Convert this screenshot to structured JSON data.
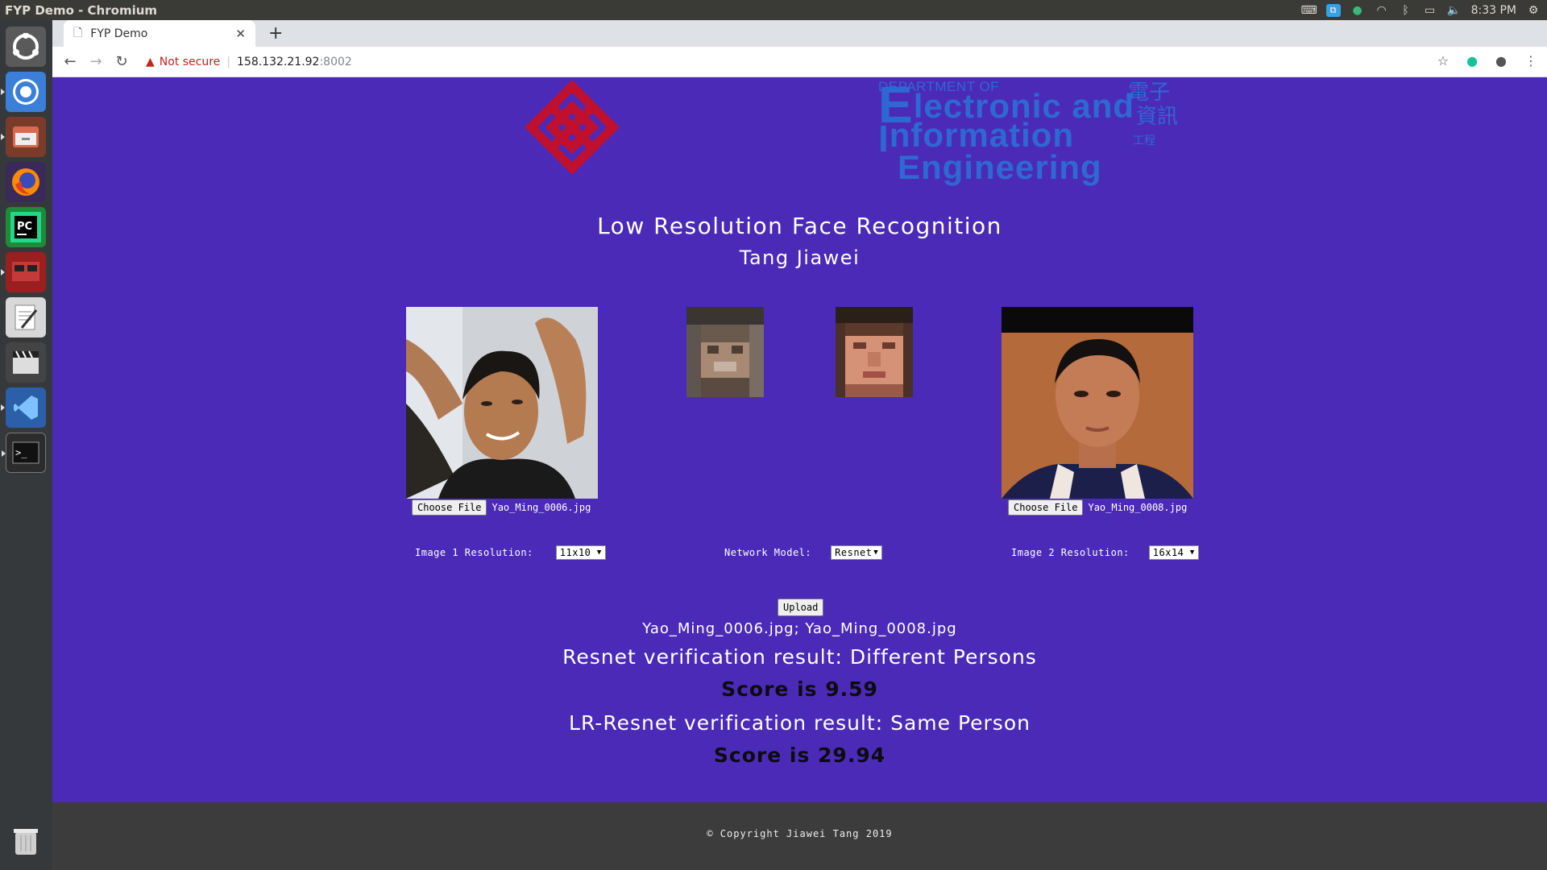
{
  "os": {
    "window_title": "FYP Demo - Chromium",
    "clock": "8:33 PM",
    "tray_icons": [
      "keyboard-icon",
      "app-indicator-icon",
      "bluetooth-alt-icon",
      "wifi-icon",
      "bluetooth-icon",
      "battery-icon",
      "volume-icon",
      "settings-icon"
    ],
    "launcher": [
      "ubuntu-dash-icon",
      "chromium-icon",
      "files-icon",
      "firefox-icon",
      "pycharm-icon",
      "remote-desktop-icon",
      "text-editor-icon",
      "video-editor-icon",
      "vscode-icon",
      "terminal-icon",
      "trash-icon"
    ]
  },
  "browser": {
    "tab_title": "FYP Demo",
    "security_label": "Not secure",
    "url_host": "158.132.21.92",
    "url_port": ":8002"
  },
  "page": {
    "header": {
      "dept_line1": "DEPARTMENT OF",
      "dept_line2_cap": "E",
      "dept_line2": "lectronic and",
      "dept_line3_cap": "I",
      "dept_line3": "nformation",
      "dept_line4": "Engineering",
      "dept_chinese": [
        "電子",
        "資訊",
        "工程"
      ]
    },
    "title": "Low Resolution Face Recognition",
    "author": "Tang Jiawei",
    "image1": {
      "choose_label": "Choose File",
      "filename": "Yao_Ming_0006.jpg"
    },
    "image2": {
      "choose_label": "Choose File",
      "filename": "Yao_Ming_0008.jpg"
    },
    "options": {
      "res1_label": "Image 1 Resolution:",
      "res1_value": "11x10",
      "model_label": "Network Model:",
      "model_value": "Resnet",
      "res2_label": "Image 2 Resolution:",
      "res2_value": "16x14"
    },
    "upload_label": "Upload",
    "results": {
      "files": "Yao_Ming_0006.jpg; Yao_Ming_0008.jpg",
      "result1": "Resnet verification result: Different Persons",
      "score1": "Score is 9.59",
      "result2": "LR-Resnet verification result: Same Person",
      "score2": "Score is 29.94"
    },
    "footer": "© Copyright Jiawei Tang 2019",
    "colors": {
      "page_bg": "#4b2ab8",
      "footer_bg": "#3c3c3c",
      "poly_red": "#c0102e",
      "dept_blue": "#2e69d2"
    }
  }
}
